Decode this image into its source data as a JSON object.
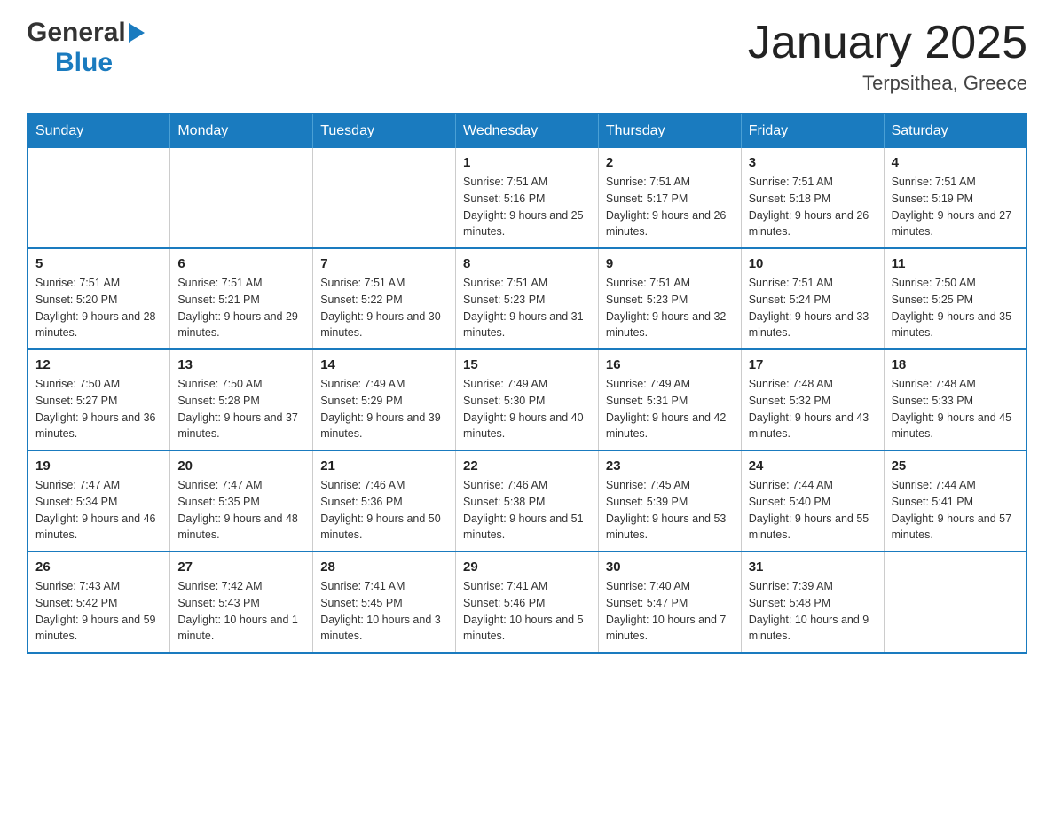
{
  "header": {
    "logo_general": "General",
    "logo_blue": "Blue",
    "month_title": "January 2025",
    "location": "Terpsithea, Greece"
  },
  "weekdays": [
    "Sunday",
    "Monday",
    "Tuesday",
    "Wednesday",
    "Thursday",
    "Friday",
    "Saturday"
  ],
  "weeks": [
    [
      {
        "day": "",
        "sunrise": "",
        "sunset": "",
        "daylight": ""
      },
      {
        "day": "",
        "sunrise": "",
        "sunset": "",
        "daylight": ""
      },
      {
        "day": "",
        "sunrise": "",
        "sunset": "",
        "daylight": ""
      },
      {
        "day": "1",
        "sunrise": "Sunrise: 7:51 AM",
        "sunset": "Sunset: 5:16 PM",
        "daylight": "Daylight: 9 hours and 25 minutes."
      },
      {
        "day": "2",
        "sunrise": "Sunrise: 7:51 AM",
        "sunset": "Sunset: 5:17 PM",
        "daylight": "Daylight: 9 hours and 26 minutes."
      },
      {
        "day": "3",
        "sunrise": "Sunrise: 7:51 AM",
        "sunset": "Sunset: 5:18 PM",
        "daylight": "Daylight: 9 hours and 26 minutes."
      },
      {
        "day": "4",
        "sunrise": "Sunrise: 7:51 AM",
        "sunset": "Sunset: 5:19 PM",
        "daylight": "Daylight: 9 hours and 27 minutes."
      }
    ],
    [
      {
        "day": "5",
        "sunrise": "Sunrise: 7:51 AM",
        "sunset": "Sunset: 5:20 PM",
        "daylight": "Daylight: 9 hours and 28 minutes."
      },
      {
        "day": "6",
        "sunrise": "Sunrise: 7:51 AM",
        "sunset": "Sunset: 5:21 PM",
        "daylight": "Daylight: 9 hours and 29 minutes."
      },
      {
        "day": "7",
        "sunrise": "Sunrise: 7:51 AM",
        "sunset": "Sunset: 5:22 PM",
        "daylight": "Daylight: 9 hours and 30 minutes."
      },
      {
        "day": "8",
        "sunrise": "Sunrise: 7:51 AM",
        "sunset": "Sunset: 5:23 PM",
        "daylight": "Daylight: 9 hours and 31 minutes."
      },
      {
        "day": "9",
        "sunrise": "Sunrise: 7:51 AM",
        "sunset": "Sunset: 5:23 PM",
        "daylight": "Daylight: 9 hours and 32 minutes."
      },
      {
        "day": "10",
        "sunrise": "Sunrise: 7:51 AM",
        "sunset": "Sunset: 5:24 PM",
        "daylight": "Daylight: 9 hours and 33 minutes."
      },
      {
        "day": "11",
        "sunrise": "Sunrise: 7:50 AM",
        "sunset": "Sunset: 5:25 PM",
        "daylight": "Daylight: 9 hours and 35 minutes."
      }
    ],
    [
      {
        "day": "12",
        "sunrise": "Sunrise: 7:50 AM",
        "sunset": "Sunset: 5:27 PM",
        "daylight": "Daylight: 9 hours and 36 minutes."
      },
      {
        "day": "13",
        "sunrise": "Sunrise: 7:50 AM",
        "sunset": "Sunset: 5:28 PM",
        "daylight": "Daylight: 9 hours and 37 minutes."
      },
      {
        "day": "14",
        "sunrise": "Sunrise: 7:49 AM",
        "sunset": "Sunset: 5:29 PM",
        "daylight": "Daylight: 9 hours and 39 minutes."
      },
      {
        "day": "15",
        "sunrise": "Sunrise: 7:49 AM",
        "sunset": "Sunset: 5:30 PM",
        "daylight": "Daylight: 9 hours and 40 minutes."
      },
      {
        "day": "16",
        "sunrise": "Sunrise: 7:49 AM",
        "sunset": "Sunset: 5:31 PM",
        "daylight": "Daylight: 9 hours and 42 minutes."
      },
      {
        "day": "17",
        "sunrise": "Sunrise: 7:48 AM",
        "sunset": "Sunset: 5:32 PM",
        "daylight": "Daylight: 9 hours and 43 minutes."
      },
      {
        "day": "18",
        "sunrise": "Sunrise: 7:48 AM",
        "sunset": "Sunset: 5:33 PM",
        "daylight": "Daylight: 9 hours and 45 minutes."
      }
    ],
    [
      {
        "day": "19",
        "sunrise": "Sunrise: 7:47 AM",
        "sunset": "Sunset: 5:34 PM",
        "daylight": "Daylight: 9 hours and 46 minutes."
      },
      {
        "day": "20",
        "sunrise": "Sunrise: 7:47 AM",
        "sunset": "Sunset: 5:35 PM",
        "daylight": "Daylight: 9 hours and 48 minutes."
      },
      {
        "day": "21",
        "sunrise": "Sunrise: 7:46 AM",
        "sunset": "Sunset: 5:36 PM",
        "daylight": "Daylight: 9 hours and 50 minutes."
      },
      {
        "day": "22",
        "sunrise": "Sunrise: 7:46 AM",
        "sunset": "Sunset: 5:38 PM",
        "daylight": "Daylight: 9 hours and 51 minutes."
      },
      {
        "day": "23",
        "sunrise": "Sunrise: 7:45 AM",
        "sunset": "Sunset: 5:39 PM",
        "daylight": "Daylight: 9 hours and 53 minutes."
      },
      {
        "day": "24",
        "sunrise": "Sunrise: 7:44 AM",
        "sunset": "Sunset: 5:40 PM",
        "daylight": "Daylight: 9 hours and 55 minutes."
      },
      {
        "day": "25",
        "sunrise": "Sunrise: 7:44 AM",
        "sunset": "Sunset: 5:41 PM",
        "daylight": "Daylight: 9 hours and 57 minutes."
      }
    ],
    [
      {
        "day": "26",
        "sunrise": "Sunrise: 7:43 AM",
        "sunset": "Sunset: 5:42 PM",
        "daylight": "Daylight: 9 hours and 59 minutes."
      },
      {
        "day": "27",
        "sunrise": "Sunrise: 7:42 AM",
        "sunset": "Sunset: 5:43 PM",
        "daylight": "Daylight: 10 hours and 1 minute."
      },
      {
        "day": "28",
        "sunrise": "Sunrise: 7:41 AM",
        "sunset": "Sunset: 5:45 PM",
        "daylight": "Daylight: 10 hours and 3 minutes."
      },
      {
        "day": "29",
        "sunrise": "Sunrise: 7:41 AM",
        "sunset": "Sunset: 5:46 PM",
        "daylight": "Daylight: 10 hours and 5 minutes."
      },
      {
        "day": "30",
        "sunrise": "Sunrise: 7:40 AM",
        "sunset": "Sunset: 5:47 PM",
        "daylight": "Daylight: 10 hours and 7 minutes."
      },
      {
        "day": "31",
        "sunrise": "Sunrise: 7:39 AM",
        "sunset": "Sunset: 5:48 PM",
        "daylight": "Daylight: 10 hours and 9 minutes."
      },
      {
        "day": "",
        "sunrise": "",
        "sunset": "",
        "daylight": ""
      }
    ]
  ]
}
